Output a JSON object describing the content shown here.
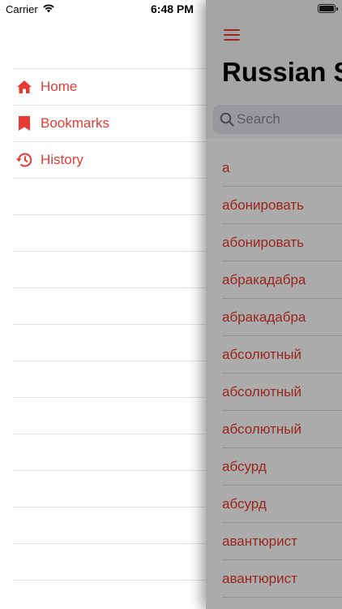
{
  "status_bar": {
    "carrier": "Carrier",
    "time": "6:48 PM"
  },
  "menu": {
    "items": [
      {
        "label": "Home",
        "icon": "home-icon"
      },
      {
        "label": "Bookmarks",
        "icon": "bookmark-icon"
      },
      {
        "label": "History",
        "icon": "history-icon"
      }
    ]
  },
  "main": {
    "title": "Russian S",
    "search_placeholder": "Search",
    "words": [
      "а",
      "абонировать",
      "абонировать",
      "абракадабра",
      "абракадабра",
      "абсолютный",
      "абсолютный",
      "абсолютный",
      "абсурд",
      "абсурд",
      "авантюрист",
      "авантюрист"
    ]
  },
  "colors": {
    "accent": "#e63a33"
  }
}
